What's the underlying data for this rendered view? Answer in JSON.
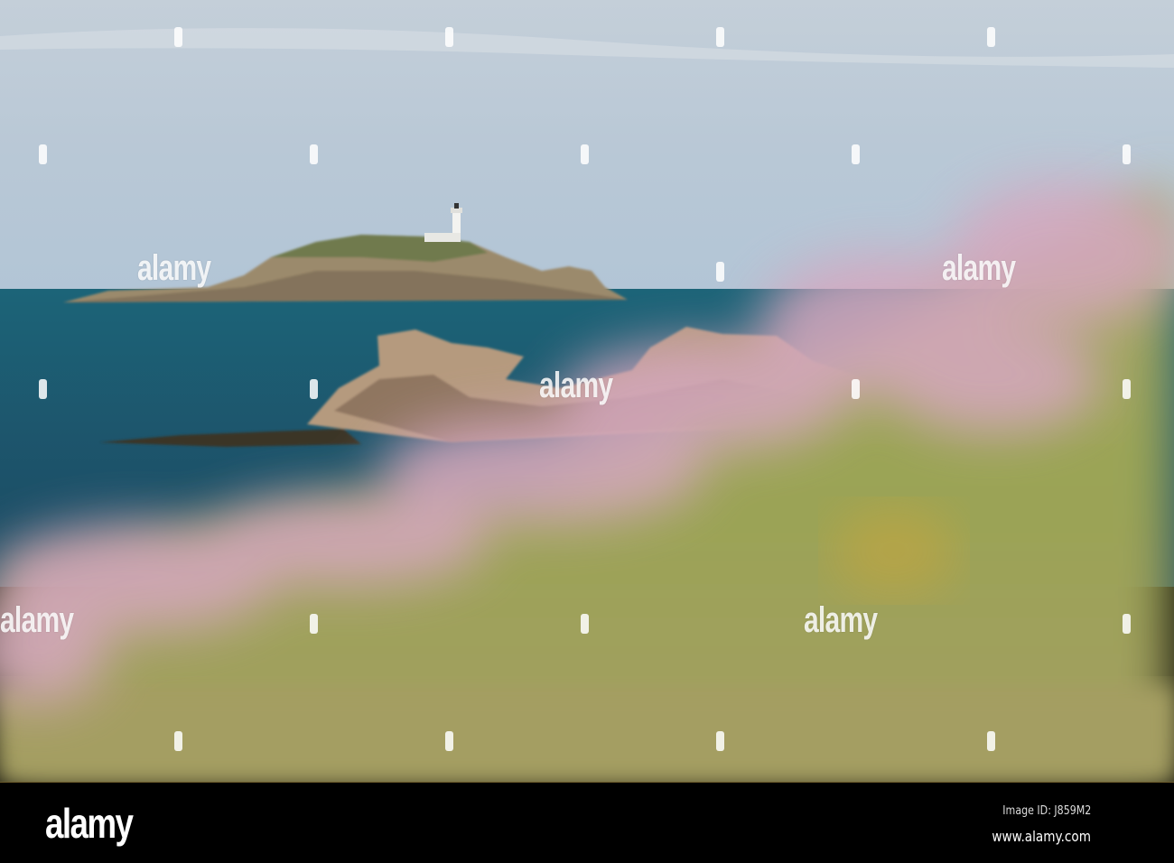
{
  "watermark": {
    "text": "alamy"
  },
  "footer": {
    "logo": "alamy",
    "image_id": "Image ID: J859M2",
    "website": "www.alamy.com"
  }
}
